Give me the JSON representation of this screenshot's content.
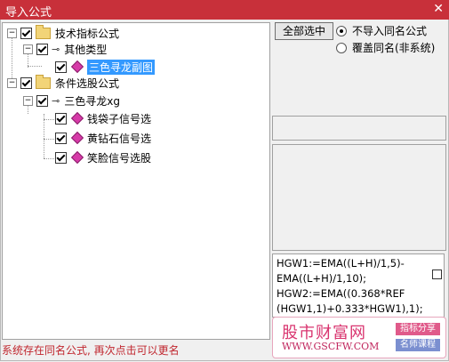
{
  "window": {
    "title": "导入公式",
    "close_glyph": "✕"
  },
  "tree": {
    "root1": {
      "label": "技术指标公式"
    },
    "group1": {
      "label": "其他类型"
    },
    "item1": {
      "label": "三色寻龙副图"
    },
    "root2": {
      "label": "条件选股公式"
    },
    "group2": {
      "label": "三色寻龙xg"
    },
    "item2": {
      "label": "钱袋子信号选"
    },
    "item3": {
      "label": "黄钻石信号选"
    },
    "item4": {
      "label": "笑脸信号选股"
    }
  },
  "actions": {
    "select_all": "全部选中",
    "radio_no_import": "不导入同名公式",
    "radio_overwrite": "覆盖同名(非系统)"
  },
  "code": {
    "lines": [
      "HGW1:=EMA((L+H)/1,5)-",
      "EMA((L+H)/1,10);",
      "HGW2:=EMA((0.368*REF",
      "(HGW1,1)+0.333*HGW1),1);"
    ]
  },
  "status": "系统存在同名公式, 再次点击可以更名",
  "watermark": {
    "name": "股市财富网",
    "url": "WWW.GSCFW.COM",
    "tag1": "指标分享",
    "tag2": "名师课程"
  },
  "colors": {
    "titlebar": "#c8303a",
    "selection": "#3399ff",
    "status": "#c0262e"
  }
}
